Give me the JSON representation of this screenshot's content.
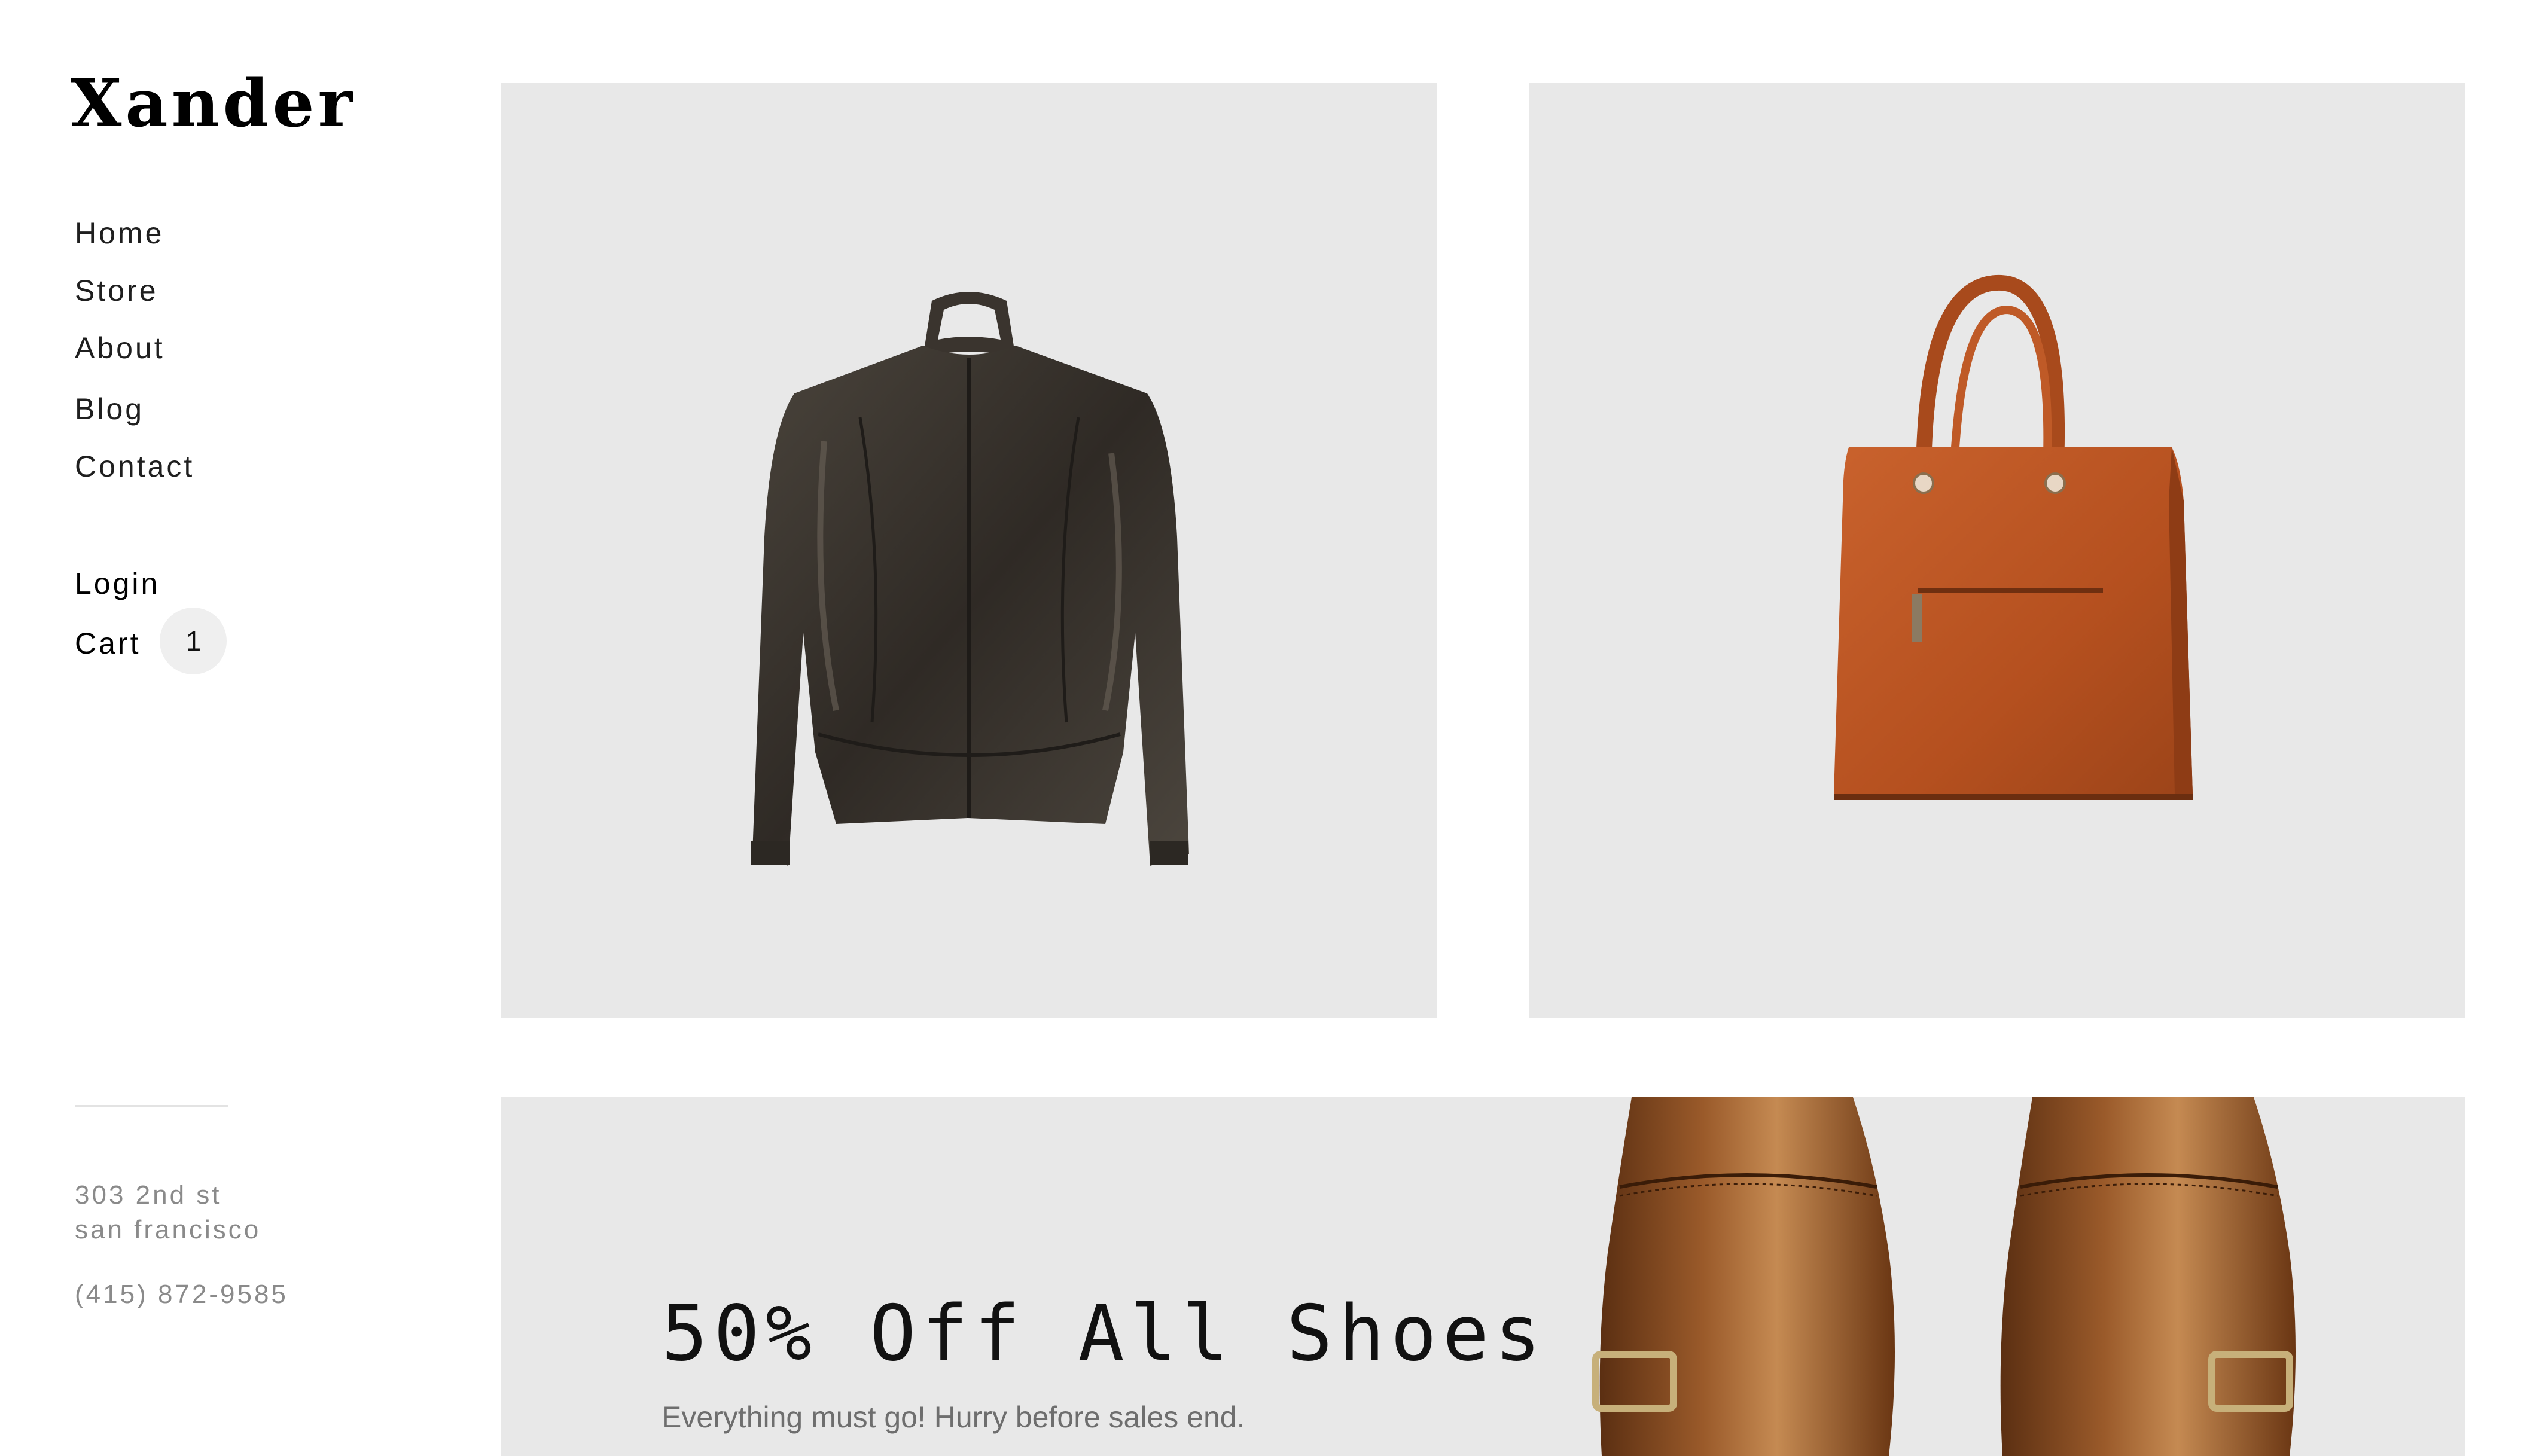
{
  "brand": {
    "logo": "Xander"
  },
  "nav": {
    "items": [
      {
        "label": "Home"
      },
      {
        "label": "Store"
      },
      {
        "label": "About"
      },
      {
        "label": "Blog"
      },
      {
        "label": "Contact"
      }
    ]
  },
  "account": {
    "login_label": "Login",
    "cart_label": "Cart",
    "cart_count": "1"
  },
  "contact": {
    "address_line1": "303 2nd st",
    "address_line2": "san francisco",
    "phone": "(415) 872-9585"
  },
  "products": [
    {
      "image": "leather-jacket"
    },
    {
      "image": "orange-leather-handbag"
    }
  ],
  "promo": {
    "title": "50% Off All Shoes",
    "subtitle": "Everything must go! Hurry before sales end.",
    "image": "brown-leather-monk-strap-shoes"
  },
  "colors": {
    "tile_background": "#e8e8e8",
    "badge_background": "#efefef",
    "muted_text": "#8a8a8a"
  }
}
